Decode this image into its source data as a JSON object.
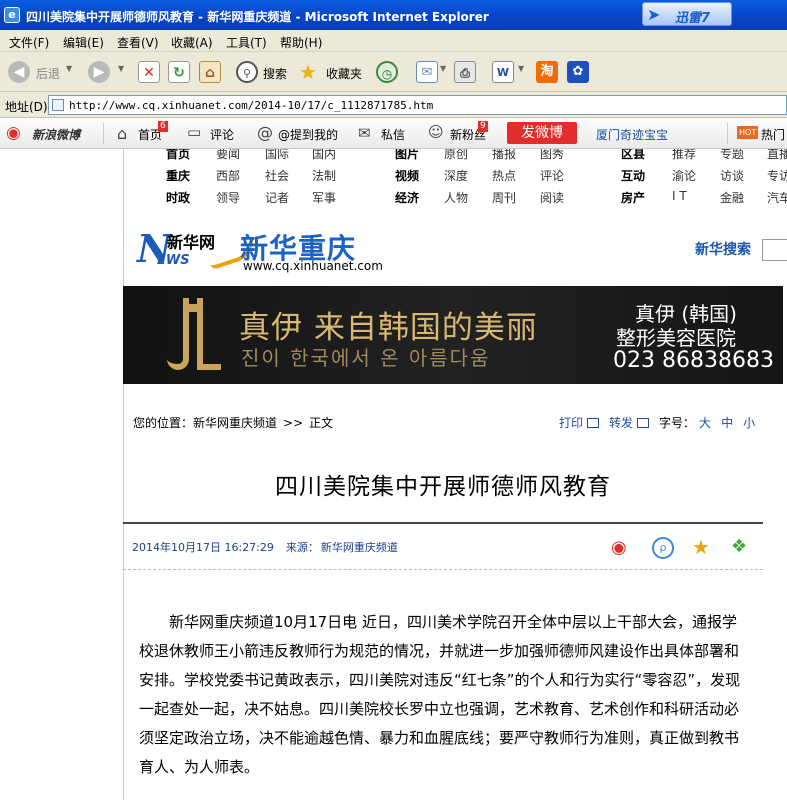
{
  "window": {
    "title": "四川美院集中开展师德师风教育 - 新华网重庆频道 - Microsoft Internet Explorer",
    "thunder_label": "迅雷7"
  },
  "menu": [
    "文件(F)",
    "编辑(E)",
    "查看(V)",
    "收藏(A)",
    "工具(T)",
    "帮助(H)"
  ],
  "toolbar": {
    "back": "后退",
    "search": "搜索",
    "favorites": "收藏夹"
  },
  "address": {
    "label": "地址(D)",
    "url": "http://www.cq.xinhuanet.com/2014-10/17/c_1112871785.htm"
  },
  "weibo": {
    "logo": "新浪微博",
    "home": "首页",
    "home_badge": "6",
    "comment": "评论",
    "mention": "@提到我的",
    "message": "私信",
    "fans": "新粉丝",
    "fans_badge": "9",
    "post": "发微博",
    "hot_topic": "厦门奇迹宝宝",
    "hot": "热门"
  },
  "topnav": {
    "row1": [
      "首页",
      "要闻",
      "国际",
      "国内",
      "图片",
      "原创",
      "播报",
      "图秀",
      "区县",
      "推荐",
      "专题",
      "直播"
    ],
    "row2": [
      "重庆",
      "西部",
      "社会",
      "法制",
      "视频",
      "深度",
      "热点",
      "评论",
      "互动",
      "渝论",
      "访谈",
      "专访"
    ],
    "row3": [
      "时政",
      "领导",
      "记者",
      "军事",
      "经济",
      "人物",
      "周刊",
      "阅读",
      "房产",
      "I T",
      "金融",
      "汽车"
    ]
  },
  "logo": {
    "n": "N",
    "xinhua": "新华网",
    "news": "EWS",
    "name": "新华重庆",
    "url": "www.cq.xinhuanet.com"
  },
  "search": {
    "label": "新华搜索"
  },
  "banner": {
    "headline": "真伊 来自韩国的美丽",
    "korean": "진이 한국에서 온 아름다움",
    "brand_line1": "真伊 (韩国)",
    "brand_line2": "整形美容医院",
    "phone": "023 86838683"
  },
  "breadcrumb": {
    "prefix": "您的位置：",
    "site": "新华网重庆频道",
    "sep": ">>",
    "current": "正文"
  },
  "tools": {
    "print": "打印",
    "forward": "转发",
    "font_label": "字号：",
    "large": "大",
    "medium": "中",
    "small": "小"
  },
  "article": {
    "title": "四川美院集中开展师德师风教育",
    "date": "2014年10月17日 16:27:29",
    "source_label": "来源：",
    "source": "新华网重庆频道",
    "body": "新华网重庆频道10月17日电 近日，四川美术学院召开全体中层以上干部大会，通报学校退休教师王小箭违反教师行为规范的情况，并就进一步加强师德师风建设作出具体部署和安排。学校党委书记黄政表示，四川美院对违反“红七条”的个人和行为实行“零容忍”，发现一起查处一起，决不姑息。四川美院校长罗中立也强调，艺术教育、艺术创作和科研活动必须坚定政治立场，决不能逾越色情、暴力和血腥底线；要严守教师行为准则，真正做到教书育人、为人师表。"
  },
  "colors": {
    "titlebar": "#0a4fd0",
    "link_blue": "#1c4fa0",
    "weibo_red": "#e22d2d",
    "banner_gold": "#d8b770"
  }
}
